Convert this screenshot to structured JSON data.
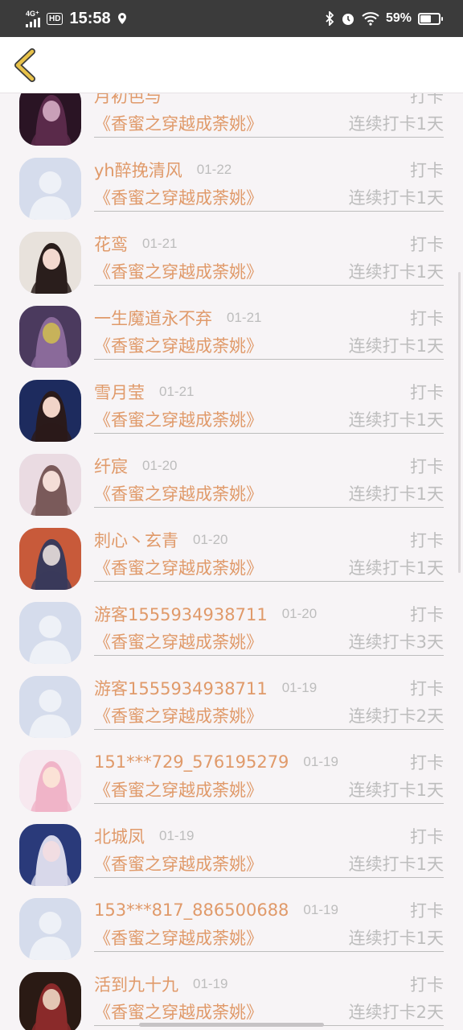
{
  "status_bar": {
    "network_type": "4G⁺",
    "hd_badge": "HD",
    "time": "15:58",
    "battery_percent": "59%",
    "battery_level": 0.59
  },
  "nav": {
    "back_icon": "back-chevron-icon",
    "accent": "#e09a6a"
  },
  "feed": {
    "items": [
      {
        "name": "月初色与",
        "date": "",
        "action": "打卡",
        "book": "《香蜜之穿越成荼姚》",
        "streak": "连续打卡1天",
        "avatar": "photo-dark"
      },
      {
        "name": "yh醉挽清风",
        "date": "01-22",
        "action": "打卡",
        "book": "《香蜜之穿越成荼姚》",
        "streak": "连续打卡1天",
        "avatar": "default"
      },
      {
        "name": "花鸾",
        "date": "01-21",
        "action": "打卡",
        "book": "《香蜜之穿越成荼姚》",
        "streak": "连续打卡1天",
        "avatar": "photo-light"
      },
      {
        "name": "一生魔道永不弃",
        "date": "01-21",
        "action": "打卡",
        "book": "《香蜜之穿越成荼姚》",
        "streak": "连续打卡1天",
        "avatar": "photo-purple"
      },
      {
        "name": "雪月莹",
        "date": "01-21",
        "action": "打卡",
        "book": "《香蜜之穿越成荼姚》",
        "streak": "连续打卡1天",
        "avatar": "photo-blue"
      },
      {
        "name": "纤宸",
        "date": "01-20",
        "action": "打卡",
        "book": "《香蜜之穿越成荼姚》",
        "streak": "连续打卡1天",
        "avatar": "photo-pink"
      },
      {
        "name": "刺心丶玄青",
        "date": "01-20",
        "action": "打卡",
        "book": "《香蜜之穿越成荼姚》",
        "streak": "连续打卡1天",
        "avatar": "photo-orange"
      },
      {
        "name": "游客1555934938711",
        "date": "01-20",
        "action": "打卡",
        "book": "《香蜜之穿越成荼姚》",
        "streak": "连续打卡3天",
        "avatar": "default"
      },
      {
        "name": "游客1555934938711",
        "date": "01-19",
        "action": "打卡",
        "book": "《香蜜之穿越成荼姚》",
        "streak": "连续打卡2天",
        "avatar": "default"
      },
      {
        "name": "151***729_576195279",
        "date": "01-19",
        "action": "打卡",
        "book": "《香蜜之穿越成荼姚》",
        "streak": "连续打卡1天",
        "avatar": "photo-anime-pink"
      },
      {
        "name": "北城凤",
        "date": "01-19",
        "action": "打卡",
        "book": "《香蜜之穿越成荼姚》",
        "streak": "连续打卡1天",
        "avatar": "photo-anime-blue"
      },
      {
        "name": "153***817_886500688",
        "date": "01-19",
        "action": "打卡",
        "book": "《香蜜之穿越成荼姚》",
        "streak": "连续打卡1天",
        "avatar": "default"
      },
      {
        "name": "活到九十九",
        "date": "01-19",
        "action": "打卡",
        "book": "《香蜜之穿越成荼姚》",
        "streak": "连续打卡2天",
        "avatar": "photo-dark-red"
      }
    ]
  }
}
